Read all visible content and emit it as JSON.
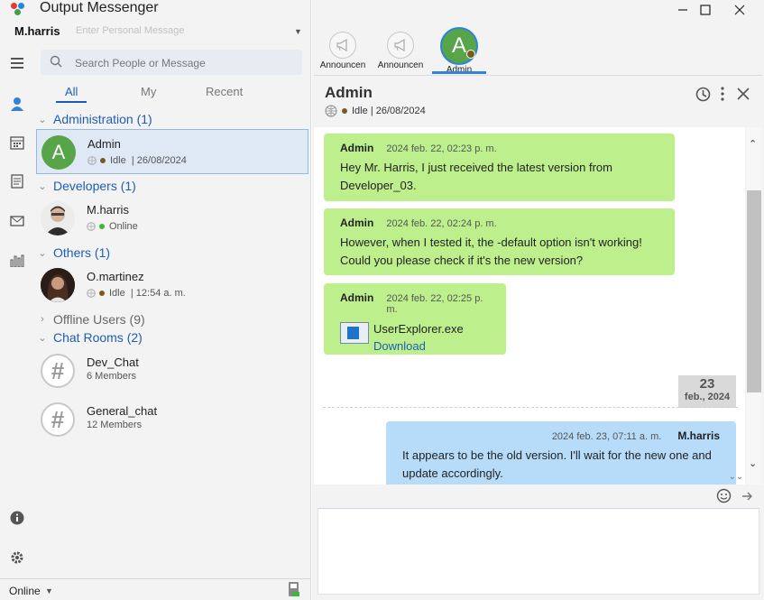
{
  "app": {
    "title": "Output Messenger"
  },
  "user": {
    "name": "M.harris",
    "personal_message_placeholder": "Enter Personal Message",
    "status": "Online"
  },
  "search": {
    "placeholder": "Search People or Message"
  },
  "tabs": [
    {
      "label": "All"
    },
    {
      "label": "My"
    },
    {
      "label": "Recent"
    }
  ],
  "groups": {
    "administration": {
      "label": "Administration (1)",
      "contacts": [
        {
          "name": "Admin",
          "initial": "A",
          "status": "Idle",
          "detail": "| 26/08/2024"
        }
      ]
    },
    "developers": {
      "label": "Developers (1)",
      "contacts": [
        {
          "name": "M.harris",
          "status": "Online"
        }
      ]
    },
    "others": {
      "label": "Others (1)",
      "contacts": [
        {
          "name": "O.martinez",
          "status": "Idle",
          "detail": "| 12:54 a. m."
        }
      ]
    },
    "offline": {
      "label": "Offline Users (9)"
    },
    "rooms": {
      "label": "Chat Rooms (2)",
      "items": [
        {
          "name": "Dev_Chat",
          "members": "6 Members"
        },
        {
          "name": "General_chat",
          "members": "12 Members"
        }
      ]
    }
  },
  "pinned": [
    {
      "label": "Announcen"
    },
    {
      "label": "Announcen"
    },
    {
      "label": "Admin",
      "initial": "A"
    }
  ],
  "chat": {
    "title": "Admin",
    "status": "Idle",
    "status_detail": "| 26/08/2024",
    "messages": [
      {
        "sender": "Admin",
        "time": "2024 feb. 22, 02:23 p. m.",
        "text": "Hey Mr. Harris, I just received the latest version from Developer_03."
      },
      {
        "sender": "Admin",
        "time": "2024 feb. 22, 02:24 p. m.",
        "text": "However, when I tested it, the -default option isn't working! Could you please check if it's the new version?"
      },
      {
        "sender": "Admin",
        "time": "2024 feb. 22, 02:25 p. m.",
        "file": "UserExplorer.exe",
        "link": "Download"
      },
      {
        "sender": "M.harris",
        "time": "2024 feb. 23, 07:11 a. m.",
        "text": "It appears to be the old version. I'll wait for the new one and update accordingly."
      }
    ],
    "date_divider": {
      "day": "23",
      "month": "feb., 2024"
    }
  },
  "colors": {
    "accent": "#1d5db8",
    "incoming": "#bdf08c",
    "outgoing": "#b7dcf9",
    "avatar_green": "#58a449",
    "idle": "#7b5a1f",
    "online": "#3fb53a"
  }
}
